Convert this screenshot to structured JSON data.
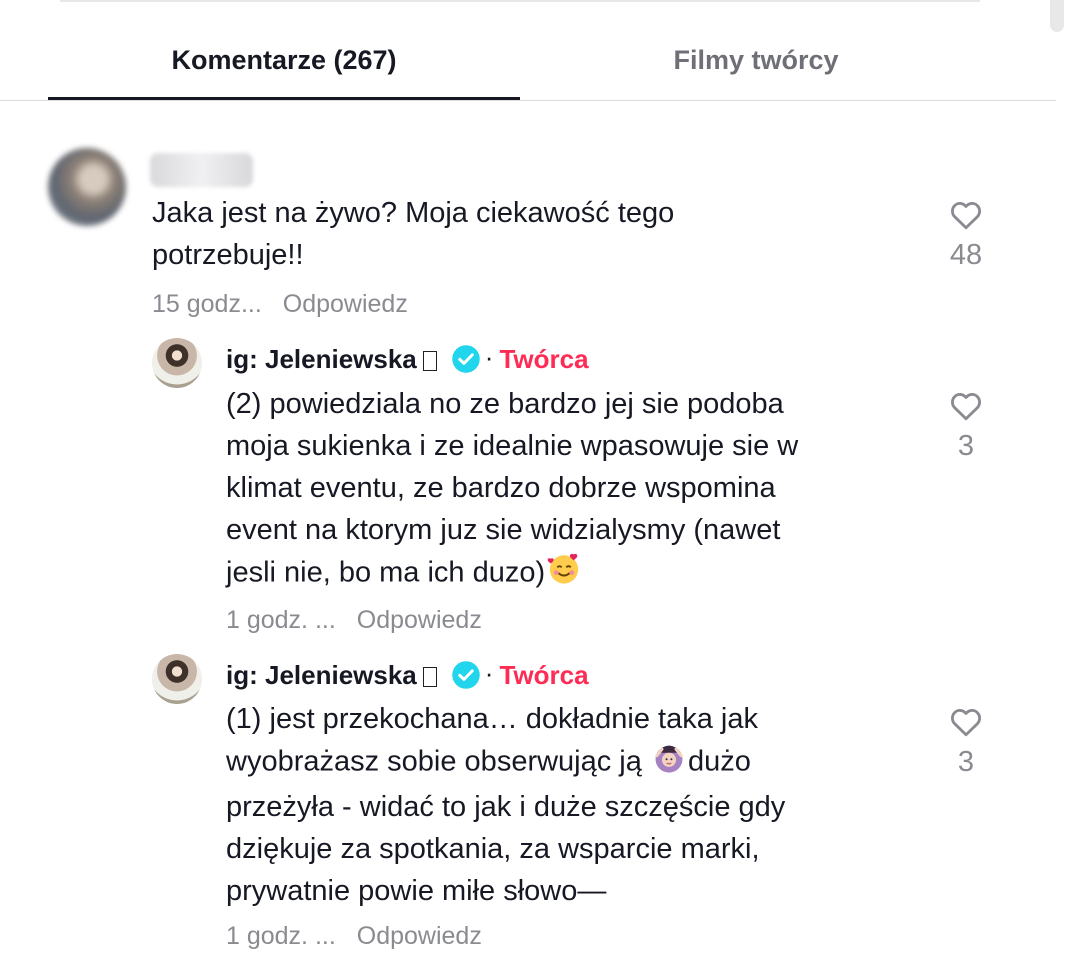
{
  "tabs": {
    "comments_label": "Komentarze (267)",
    "films_label": "Filmy twórcy"
  },
  "colors": {
    "creator_accent": "#fe2c55",
    "verified": "#20d5ec",
    "muted": "#8a8b91",
    "text": "#161823"
  },
  "comments": [
    {
      "username": "",
      "text": "Jaka jest na żywo? Moja ciekawość tego\npotrzebuje!!",
      "time": "15 godz...",
      "reply_label": "Odpowiedz",
      "likes": "48",
      "avatar_icon": "blurred-avatar"
    }
  ],
  "replies": [
    {
      "username": "ig: Jeleniewska",
      "badge_icon": "verified-icon",
      "separator": "·",
      "role": "Twórca",
      "text_before": "(2) powiedziala no ze bardzo jej sie podoba\nmoja sukienka i ze idealnie wpasowuje sie w\nklimat eventu, ze bardzo dobrze wspomina\nevent na ktorym juz sie widzialysmy (nawet\njesli nie, bo ma ich duzo)",
      "emoji": "🥰",
      "time": "1 godz. ...",
      "reply_label": "Odpowiedz",
      "likes": "3"
    },
    {
      "username": "ig: Jeleniewska",
      "badge_icon": "verified-icon",
      "separator": "·",
      "role": "Twórca",
      "text_line1": "(1) jest przekochana… dokładnie taka jak",
      "text_line2_before": "wyobrażasz sobie obserwując ją ",
      "emoji": "🙆🏻‍♀️",
      "text_line2_after": "dużo",
      "text_rest": "przeżyła - widać to jak i duże szczęście gdy\ndziękuje za spotkania, za wsparcie marki,\nprywatnie powie miłe słowo—",
      "time": "1 godz. ...",
      "reply_label": "Odpowiedz",
      "likes": "3"
    }
  ]
}
